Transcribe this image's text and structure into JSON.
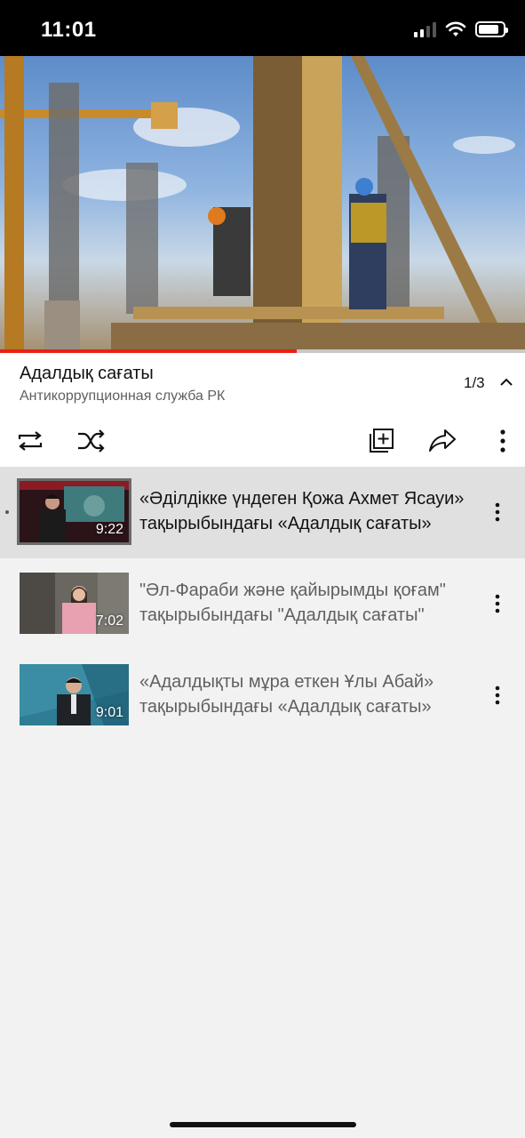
{
  "status_bar": {
    "time": "11:01",
    "battery_level": 0.85
  },
  "player": {
    "progress": 0.565,
    "accent_color": "#e62117"
  },
  "playlist": {
    "title": "Адалдық сағаты",
    "channel": "Антикоррупционная служба РК",
    "position": "1/3"
  },
  "controls": [
    "repeat-icon",
    "shuffle-icon",
    "save-to-playlist-icon",
    "share-icon",
    "more-options-icon"
  ],
  "items": [
    {
      "title": "«Әділдікке үндеген Қожа Ахмет Ясауи» тақырыбындағы «Адалдық сағаты»",
      "duration": "9:22",
      "now_playing": true
    },
    {
      "title": "\"Әл-Фараби және қайырымды қоғам\" тақырыбындағы \"Адалдық сағаты\"",
      "duration": "7:02",
      "now_playing": false
    },
    {
      "title": "«Адалдықты мұра еткен Ұлы Абай» тақырыбындағы «Адалдық сағаты»",
      "duration": "9:01",
      "now_playing": false
    }
  ]
}
